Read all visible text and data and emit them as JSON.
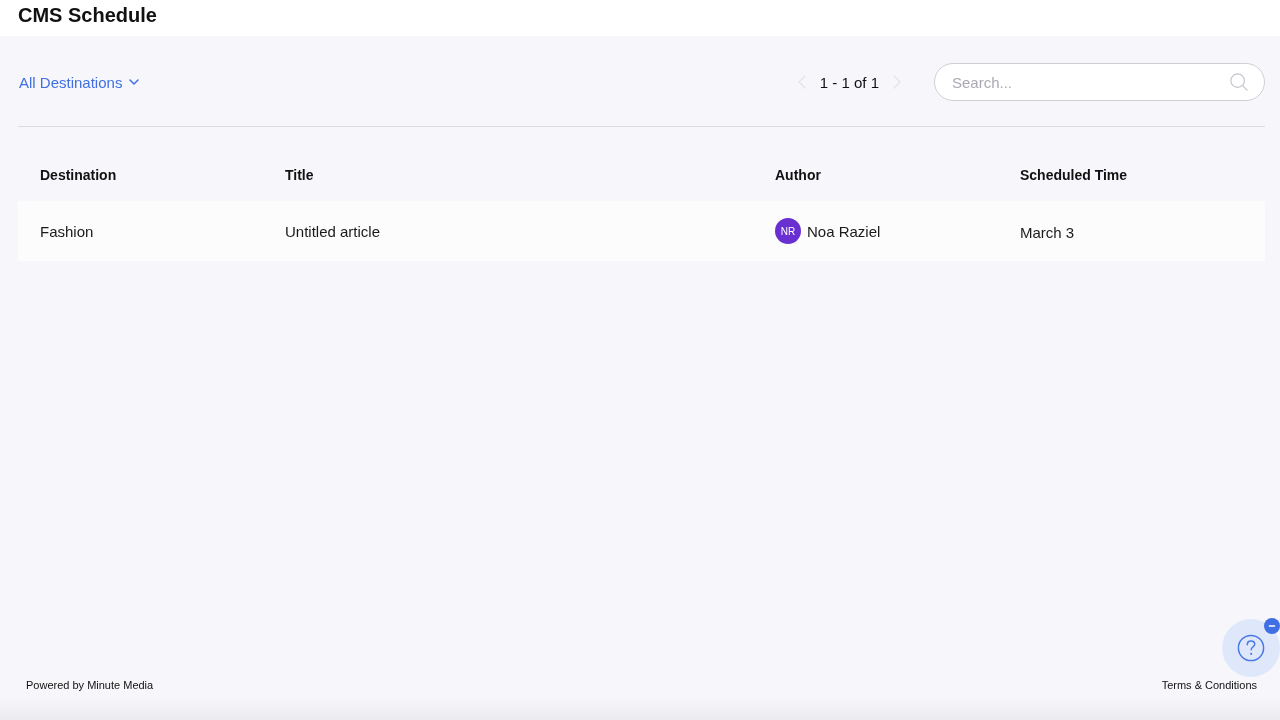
{
  "header": {
    "title": "CMS Schedule"
  },
  "toolbar": {
    "filter": {
      "label": "All Destinations"
    },
    "pager": {
      "range": "1 - 1 of 1",
      "previous_disabled": true,
      "next_disabled": true
    },
    "search": {
      "placeholder": "Search..."
    }
  },
  "table": {
    "columns": [
      "Destination",
      "Title",
      "Author",
      "Scheduled Time"
    ],
    "rows": [
      {
        "destination": "Fashion",
        "title": "Untitled article",
        "author": {
          "initials": "NR",
          "name": "Noa Raziel"
        },
        "scheduled_time": "March 3"
      }
    ]
  },
  "footer": {
    "left": "Powered by Minute Media",
    "right": "Terms & Conditions"
  },
  "help": {
    "badge_visible": true
  }
}
